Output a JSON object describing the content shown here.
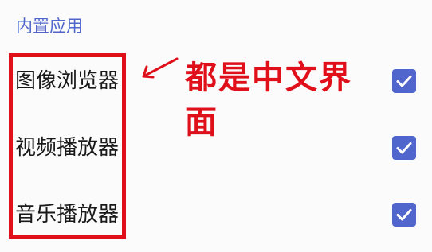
{
  "section": {
    "title": "内置应用"
  },
  "apps": [
    {
      "label": "图像浏览器",
      "checked": true
    },
    {
      "label": "视频播放器",
      "checked": true
    },
    {
      "label": "音乐播放器",
      "checked": true
    }
  ],
  "annotation": {
    "text": "都是中文界面",
    "color": "#e0101b"
  },
  "colors": {
    "accent": "#5166cc",
    "checkbox": "#5166cc",
    "annotation": "#e0101b"
  },
  "icons": {
    "checkbox": "checkbox-checked-icon",
    "arrow": "arrow-icon"
  }
}
